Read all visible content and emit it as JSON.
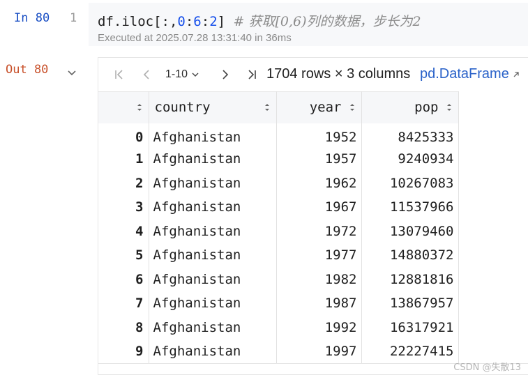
{
  "input_cell": {
    "prompt": "In 80",
    "line_number": "1",
    "code": {
      "prefix": "df.iloc[:,",
      "num1": "0",
      "colon1": ":",
      "num2": "6",
      "colon2": ":",
      "num3": "2",
      "suffix": "] ",
      "comment": "# 获取[0,6)列的数据，步长为2"
    },
    "exec_info": "Executed at 2025.07.28 13:31:40 in 36ms"
  },
  "output_cell": {
    "prompt": "Out 80",
    "toolbar": {
      "page_range": "1-10",
      "shape_info": "1704 rows × 3 columns",
      "type_link": "pd.DataFrame"
    },
    "table": {
      "columns": [
        "country",
        "year",
        "pop"
      ],
      "rows": [
        {
          "index": "0",
          "country": "Afghanistan",
          "year": "1952",
          "pop": "8425333"
        },
        {
          "index": "1",
          "country": "Afghanistan",
          "year": "1957",
          "pop": "9240934"
        },
        {
          "index": "2",
          "country": "Afghanistan",
          "year": "1962",
          "pop": "10267083"
        },
        {
          "index": "3",
          "country": "Afghanistan",
          "year": "1967",
          "pop": "11537966"
        },
        {
          "index": "4",
          "country": "Afghanistan",
          "year": "1972",
          "pop": "13079460"
        },
        {
          "index": "5",
          "country": "Afghanistan",
          "year": "1977",
          "pop": "14880372"
        },
        {
          "index": "6",
          "country": "Afghanistan",
          "year": "1982",
          "pop": "12881816"
        },
        {
          "index": "7",
          "country": "Afghanistan",
          "year": "1987",
          "pop": "13867957"
        },
        {
          "index": "8",
          "country": "Afghanistan",
          "year": "1992",
          "pop": "16317921"
        },
        {
          "index": "9",
          "country": "Afghanistan",
          "year": "1997",
          "pop": "22227415"
        }
      ]
    }
  },
  "watermark": "CSDN @失散13",
  "colors": {
    "in_prompt": "#1a4fc4",
    "out_prompt": "#c8502a",
    "number_literal": "#1750eb",
    "comment": "#8c8c8c",
    "link": "#2a62c9",
    "header_bg": "#f6f7f9"
  }
}
